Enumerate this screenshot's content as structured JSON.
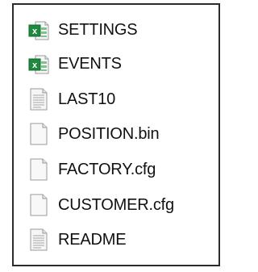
{
  "window": {
    "border_color": "#2b2b2b",
    "background": "#ffffff"
  },
  "files": [
    {
      "name": "SETTINGS",
      "icon": "excel-file-icon"
    },
    {
      "name": "EVENTS",
      "icon": "excel-file-icon"
    },
    {
      "name": "LAST10",
      "icon": "text-document-icon"
    },
    {
      "name": "POSITION.bin",
      "icon": "blank-file-icon"
    },
    {
      "name": "FACTORY.cfg",
      "icon": "blank-file-icon"
    },
    {
      "name": "CUSTOMER.cfg",
      "icon": "blank-file-icon"
    },
    {
      "name": "README",
      "icon": "text-document-icon"
    }
  ],
  "colors": {
    "excel_green": "#1e8a3e",
    "excel_green_dark": "#0f6b2b",
    "page_fill": "#f6f6f6",
    "page_outline": "#9a9a9a",
    "text_lines": "#a7a7a7"
  }
}
